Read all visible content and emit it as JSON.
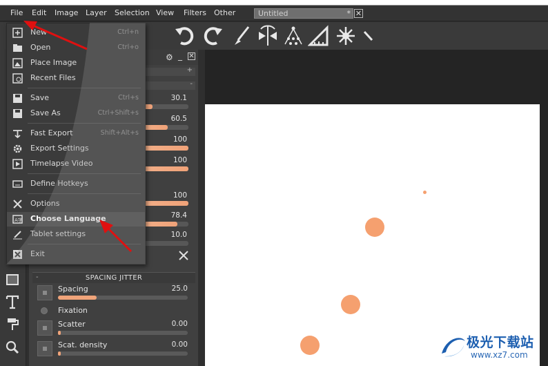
{
  "menubar": {
    "items": [
      "File",
      "Edit",
      "Image",
      "Layer",
      "Selection",
      "View",
      "Filters",
      "Other"
    ],
    "document_tab": "Untitled",
    "document_tab_modified": "*"
  },
  "file_menu": {
    "items": [
      {
        "label": "New",
        "shortcut": "Ctrl+n",
        "icon": "new-file-icon"
      },
      {
        "label": "Open",
        "shortcut": "Ctrl+o",
        "icon": "open-folder-icon"
      },
      {
        "label": "Place Image",
        "shortcut": "",
        "icon": "place-image-icon"
      },
      {
        "label": "Recent Files",
        "shortcut": "",
        "icon": "recent-files-icon"
      },
      {
        "label": "Save",
        "shortcut": "Ctrl+s",
        "icon": "save-icon"
      },
      {
        "label": "Save As",
        "shortcut": "Ctrl+Shift+s",
        "icon": "save-as-icon"
      },
      {
        "label": "Fast Export",
        "shortcut": "Shift+Alt+s",
        "icon": "export-icon"
      },
      {
        "label": "Export Settings",
        "shortcut": "",
        "icon": "gear-icon"
      },
      {
        "label": "Timelapse Video",
        "shortcut": "",
        "icon": "video-icon"
      },
      {
        "label": "Define Hotkeys",
        "shortcut": "",
        "icon": "keyboard-icon"
      },
      {
        "label": "Options",
        "shortcut": "",
        "icon": "tools-icon"
      },
      {
        "label": "Choose Language",
        "shortcut": "",
        "icon": "language-icon"
      },
      {
        "label": "Tablet settings",
        "shortcut": "",
        "icon": "tablet-pen-icon"
      },
      {
        "label": "Exit",
        "shortcut": "",
        "icon": "close-icon"
      }
    ],
    "highlighted": "Choose Language"
  },
  "brush_panel": {
    "sliders": [
      {
        "value": "30.1",
        "level": 0.3
      },
      {
        "value": "60.5",
        "level": 0.6
      },
      {
        "value": "100",
        "level": 1.0
      },
      {
        "value": "100",
        "level": 1.0
      },
      {
        "value": "100",
        "level": 1.0
      },
      {
        "value": "78.4",
        "level": 0.78
      },
      {
        "value": "10.0",
        "level": 0.1
      }
    ]
  },
  "spacing_jitter": {
    "title": "SPACING JITTER",
    "spacing": {
      "label": "Spacing",
      "value": "25.0",
      "level": 0.3
    },
    "fixation": {
      "label": "Fixation"
    },
    "scatter": {
      "label": "Scatter",
      "value": "0.00",
      "level": 0.02
    },
    "scat_density": {
      "label": "Scat. density",
      "value": "0.00",
      "level": 0.02
    }
  },
  "watermark": {
    "text": "极光下载站",
    "url": "www.xz7.com"
  },
  "colors": {
    "accent": "#f5a06f",
    "arrow": "#e01010"
  }
}
